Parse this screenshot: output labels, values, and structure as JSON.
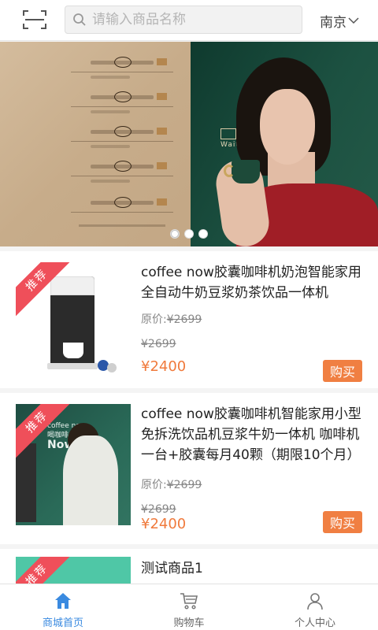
{
  "header": {
    "search_placeholder": "请输入商品名称",
    "city": "南京"
  },
  "banner": {
    "logo_text": "Wait",
    "slide_count": 3,
    "active_slide": 0
  },
  "products": [
    {
      "badge": "推荐",
      "title": "coffee now胶囊咖啡机奶泡智能家用全自动牛奶豆浆奶茶饮品一体机",
      "orig_label": "原价:",
      "orig_price": "¥2699",
      "strike_price": "¥2699",
      "price": "¥2400",
      "buy_label": "购买"
    },
    {
      "badge": "推荐",
      "title": "coffee now胶囊咖啡机智能家用小型免拆洗饮品机豆浆牛奶一体机 咖啡机一台+胶囊每月40颗（期限10个月）",
      "orig_label": "原价:",
      "orig_price": "¥2699",
      "strike_price": "¥2699",
      "price": "¥2400",
      "buy_label": "购买",
      "image_text": {
        "small": "coffee now",
        "mid": "喝咖啡",
        "big": "Now!"
      }
    },
    {
      "badge": "推荐",
      "title": "测试商品1"
    }
  ],
  "tabbar": {
    "items": [
      {
        "label": "商城首页",
        "icon": "home-icon",
        "active": true
      },
      {
        "label": "购物车",
        "icon": "cart-icon",
        "active": false
      },
      {
        "label": "个人中心",
        "icon": "user-icon",
        "active": false
      }
    ]
  },
  "colors": {
    "accent": "#3a8ae0",
    "price": "#f07a3c",
    "buy_button": "#f07f42",
    "badge": "#ef4f5a"
  }
}
